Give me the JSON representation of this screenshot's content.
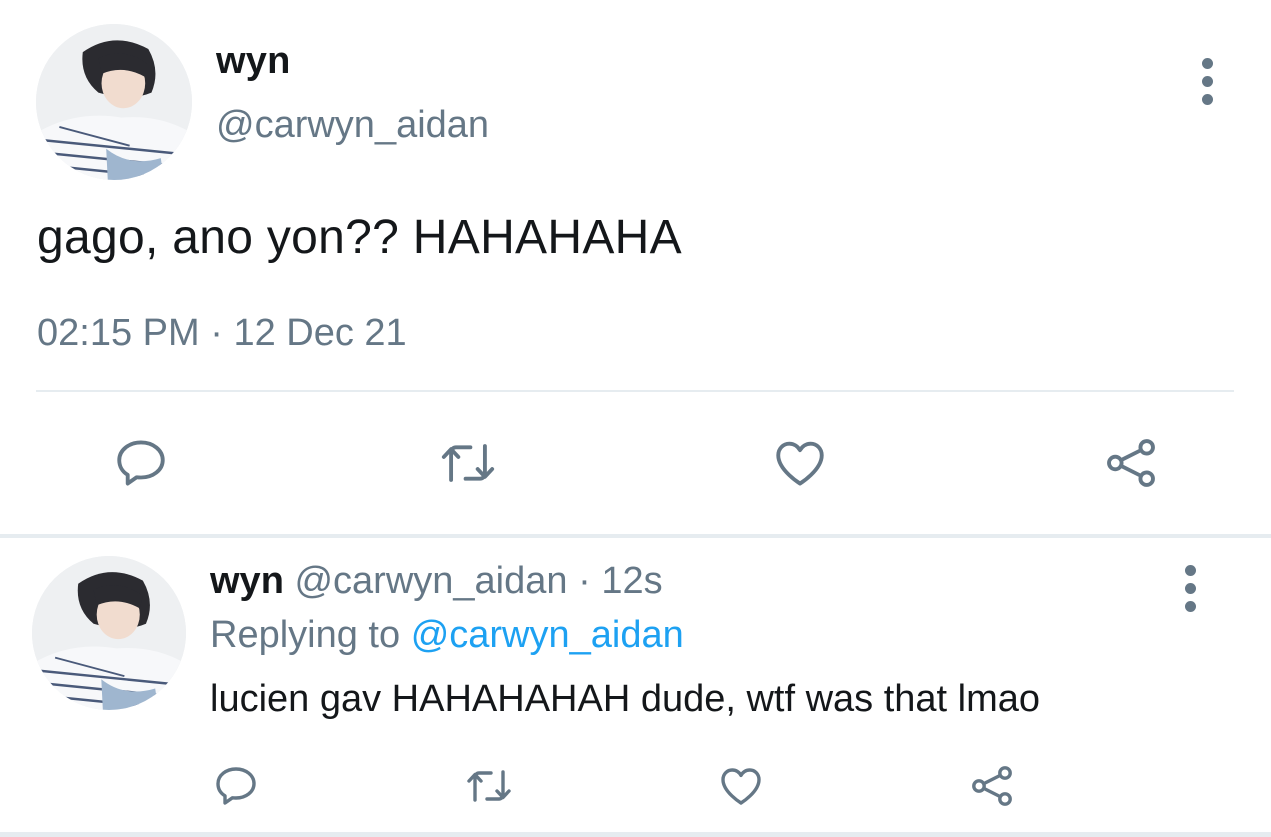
{
  "main_tweet": {
    "display_name": "wyn",
    "handle": "@carwyn_aidan",
    "text": "gago, ano yon?? HAHAHAHA",
    "time": "02:15 PM",
    "separator": "·",
    "date": "12 Dec 21",
    "actions": [
      "reply-icon",
      "retweet-icon",
      "like-icon",
      "share-icon"
    ]
  },
  "reply": {
    "display_name": "wyn",
    "handle": "@carwyn_aidan",
    "separator": "·",
    "age": "12s",
    "replying_prefix": "Replying to",
    "replying_to": "@carwyn_aidan",
    "text": "lucien gav HAHAHAHAH dude, wtf was that lmao",
    "actions": [
      "reply-icon",
      "retweet-icon",
      "like-icon",
      "share-icon"
    ]
  },
  "colors": {
    "text_primary": "#14171a",
    "text_secondary": "#657786",
    "link": "#1da1f2",
    "divider": "#e6ecf0"
  }
}
